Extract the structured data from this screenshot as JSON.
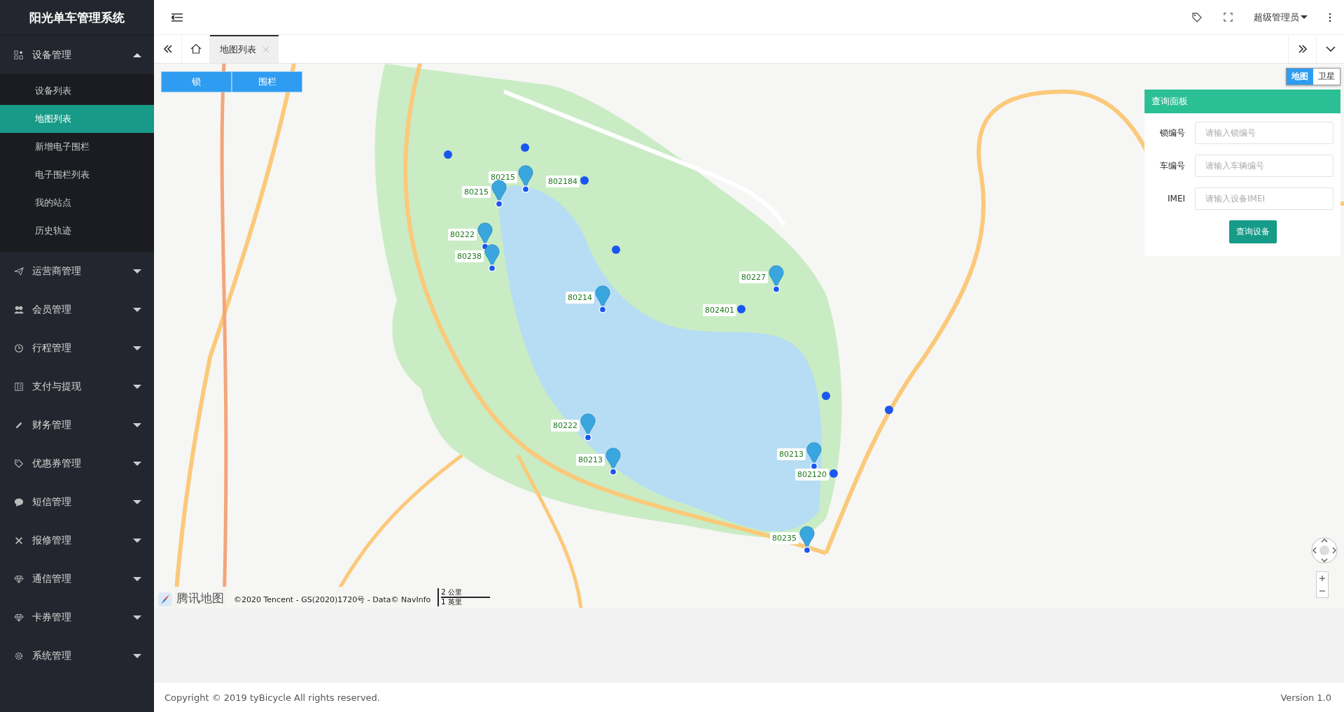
{
  "app_title": "阳光单车管理系统",
  "sidebar": {
    "groups": [
      {
        "label": "设备管理",
        "expanded": true,
        "children": [
          {
            "label": "设备列表",
            "selected": false
          },
          {
            "label": "地图列表",
            "selected": true
          },
          {
            "label": "新增电子围栏",
            "selected": false
          },
          {
            "label": "电子围栏列表",
            "selected": false
          },
          {
            "label": "我的站点",
            "selected": false
          },
          {
            "label": "历史轨迹",
            "selected": false
          }
        ]
      },
      {
        "label": "运营商管理",
        "expanded": false
      },
      {
        "label": "会员管理",
        "expanded": false
      },
      {
        "label": "行程管理",
        "expanded": false
      },
      {
        "label": "支付与提现",
        "expanded": false
      },
      {
        "label": "财务管理",
        "expanded": false
      },
      {
        "label": "优惠券管理",
        "expanded": false
      },
      {
        "label": "短信管理",
        "expanded": false
      },
      {
        "label": "报修管理",
        "expanded": false
      },
      {
        "label": "通信管理",
        "expanded": false
      },
      {
        "label": "卡券管理",
        "expanded": false
      },
      {
        "label": "系统管理",
        "expanded": false
      }
    ]
  },
  "header": {
    "user": "超级管理员"
  },
  "tabs": [
    {
      "label": "地图列表",
      "selected": true
    }
  ],
  "map": {
    "layer_buttons": [
      {
        "label": "锁"
      },
      {
        "label": "围栏"
      }
    ],
    "map_types": [
      {
        "label": "地图",
        "selected": true
      },
      {
        "label": "卫星",
        "selected": false
      }
    ],
    "markers": [
      {
        "label": "80215"
      },
      {
        "label": "80215"
      },
      {
        "label": "802184"
      },
      {
        "label": "80222"
      },
      {
        "label": "80238"
      },
      {
        "label": "80214"
      },
      {
        "label": "80227"
      },
      {
        "label": "802401"
      },
      {
        "label": "80222"
      },
      {
        "label": "80213"
      },
      {
        "label": "80213"
      },
      {
        "label": "802120"
      },
      {
        "label": "80235"
      }
    ],
    "logo_text": "腾讯地图",
    "attribution": "©2020 Tencent - GS(2020)1720号 - Data© NavInfo",
    "scale": [
      "2 公里",
      "1 英里"
    ]
  },
  "query_panel": {
    "title": "查询面板",
    "fields": [
      {
        "label": "锁编号",
        "placeholder": "请输入锁编号"
      },
      {
        "label": "车编号",
        "placeholder": "请输入车辆编号"
      },
      {
        "label": "IMEI",
        "placeholder": "请输入设备IMEI"
      }
    ],
    "button": "查询设备"
  },
  "footer": {
    "copyright": "Copyright © 2019 tyBicycle All rights reserved.",
    "version": "Version 1.0"
  }
}
